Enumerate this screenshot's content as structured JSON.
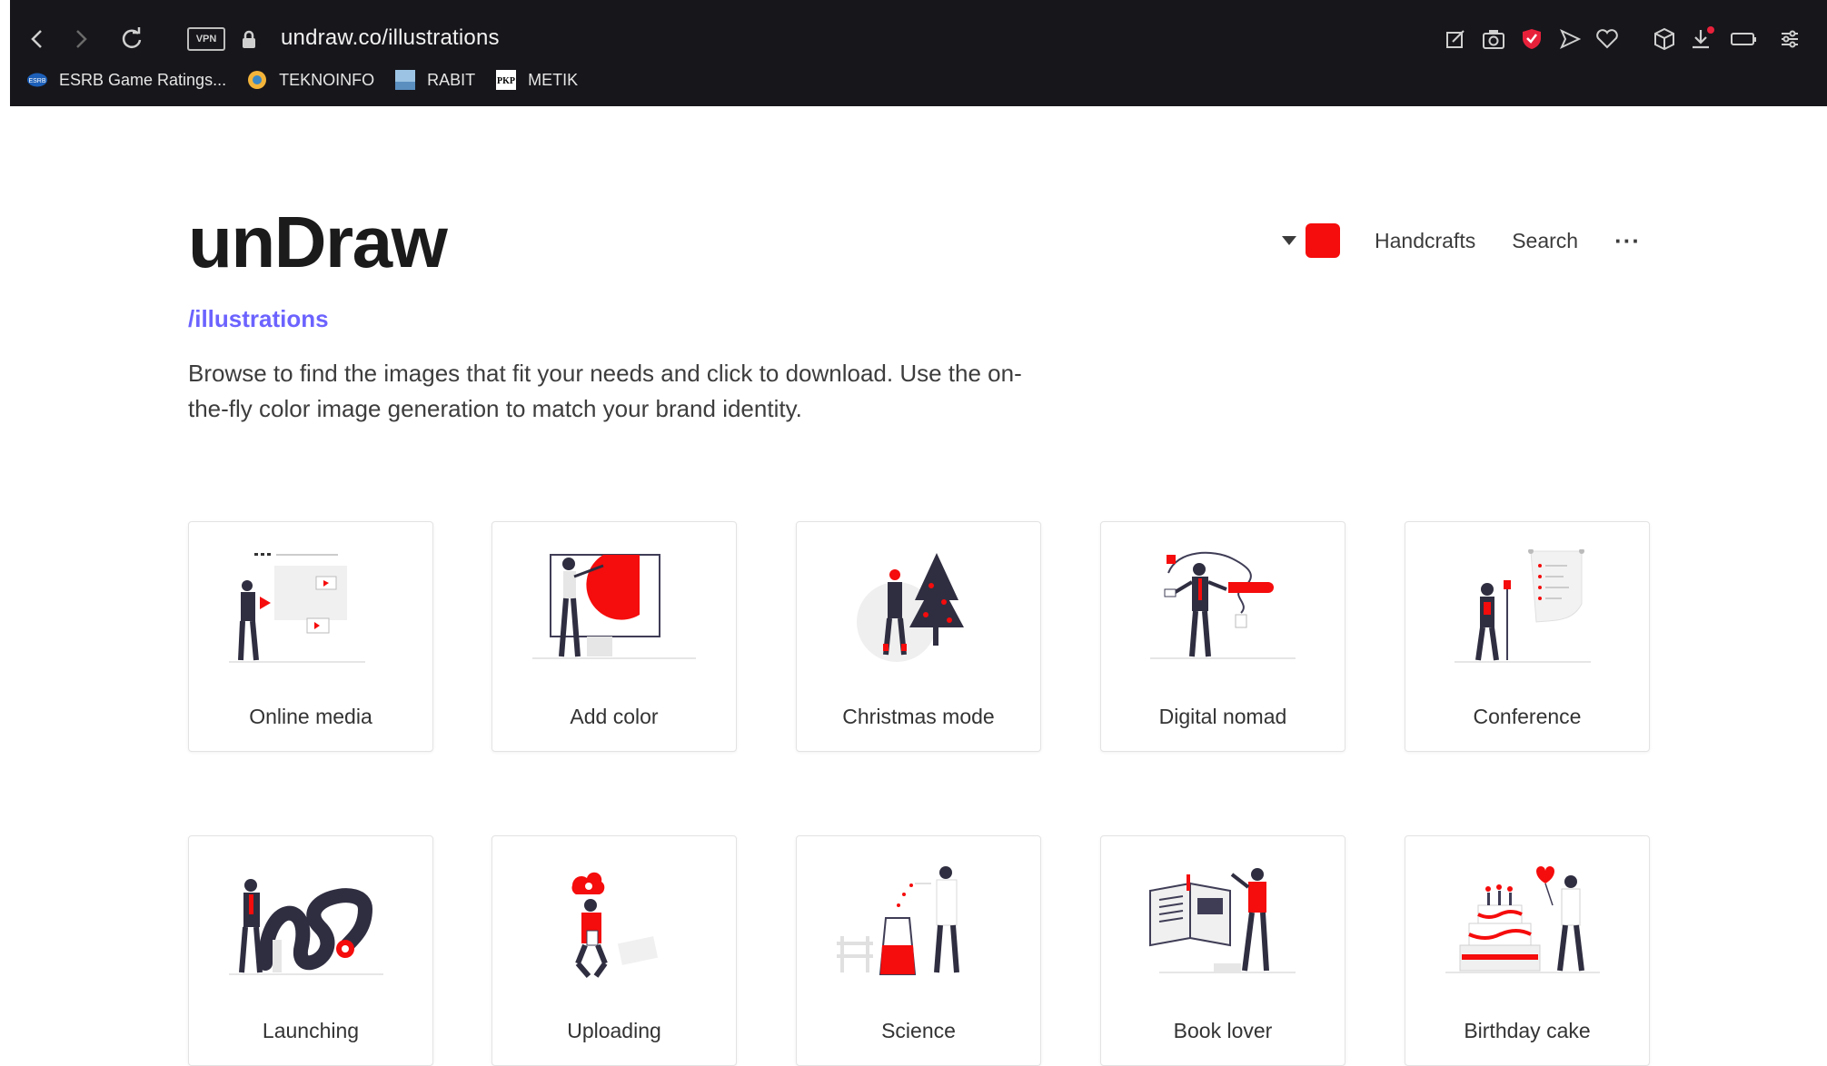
{
  "browser": {
    "url": "undraw.co/illustrations",
    "vpn_label": "VPN",
    "bookmarks": [
      {
        "label": "ESRB Game Ratings...",
        "icon": "esrb-icon"
      },
      {
        "label": "TEKNOINFO",
        "icon": "teknoinfo-icon"
      },
      {
        "label": "RABIT",
        "icon": "rabit-icon"
      },
      {
        "label": "METIK",
        "icon": "metik-icon"
      }
    ]
  },
  "header": {
    "logo": "unDraw",
    "subpath": "/illustrations",
    "description": "Browse to find the images that fit your needs and click to download. Use the on-the-fly color image generation to match your brand identity.",
    "accent_color": "#f50c0c",
    "nav": {
      "handcrafts": "Handcrafts",
      "search": "Search",
      "more": "···"
    }
  },
  "illustrations": [
    {
      "label": "Online media"
    },
    {
      "label": "Add color"
    },
    {
      "label": "Christmas mode"
    },
    {
      "label": "Digital nomad"
    },
    {
      "label": "Conference"
    },
    {
      "label": "Launching"
    },
    {
      "label": "Uploading"
    },
    {
      "label": "Science"
    },
    {
      "label": "Book lover"
    },
    {
      "label": "Birthday cake"
    }
  ]
}
